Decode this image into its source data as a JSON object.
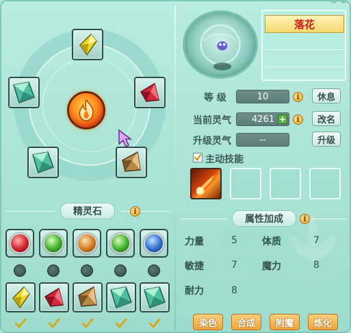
{
  "spirit": {
    "name": "落花"
  },
  "stats": {
    "level_label": "等  级",
    "level_value": "10",
    "spirit_label": "当前灵气",
    "spirit_value": "4261",
    "upgrade_label": "升级灵气",
    "upgrade_value": "--"
  },
  "buttons": {
    "rest": "休息",
    "rename": "改名",
    "upgrade": "升级"
  },
  "skills": {
    "active_label": "主动技能",
    "active_checked": true
  },
  "spirit_stone": {
    "title": "精灵石",
    "orbs": [
      "red-orb",
      "green-orb",
      "orange-orb",
      "green-orb",
      "blue-orb"
    ],
    "gems": [
      "yellow-gem",
      "red-gem",
      "brown-gem",
      "teal-gem",
      "teal-gem"
    ],
    "checked": [
      true,
      true,
      true,
      true,
      true
    ]
  },
  "wheel": {
    "gems": [
      "yellow-gem",
      "red-gem",
      "brown-gem",
      "teal-gem",
      "teal-gem"
    ],
    "core_icon": "flame-emblem-icon"
  },
  "attributes": {
    "title": "属性加成",
    "strength_label": "力量",
    "strength_value": "5",
    "constitution_label": "体质",
    "constitution_value": "7",
    "agility_label": "敏捷",
    "agility_value": "7",
    "magic_label": "魔力",
    "magic_value": "8",
    "endurance_label": "耐力",
    "endurance_value": "8"
  },
  "actions": {
    "dye": "染色",
    "combine": "合成",
    "enchant": "附魔",
    "refine": "炼化"
  },
  "colors": {
    "background": "#aee6d8",
    "name_text": "#c81c1c",
    "action_button": "#f0a33a"
  }
}
